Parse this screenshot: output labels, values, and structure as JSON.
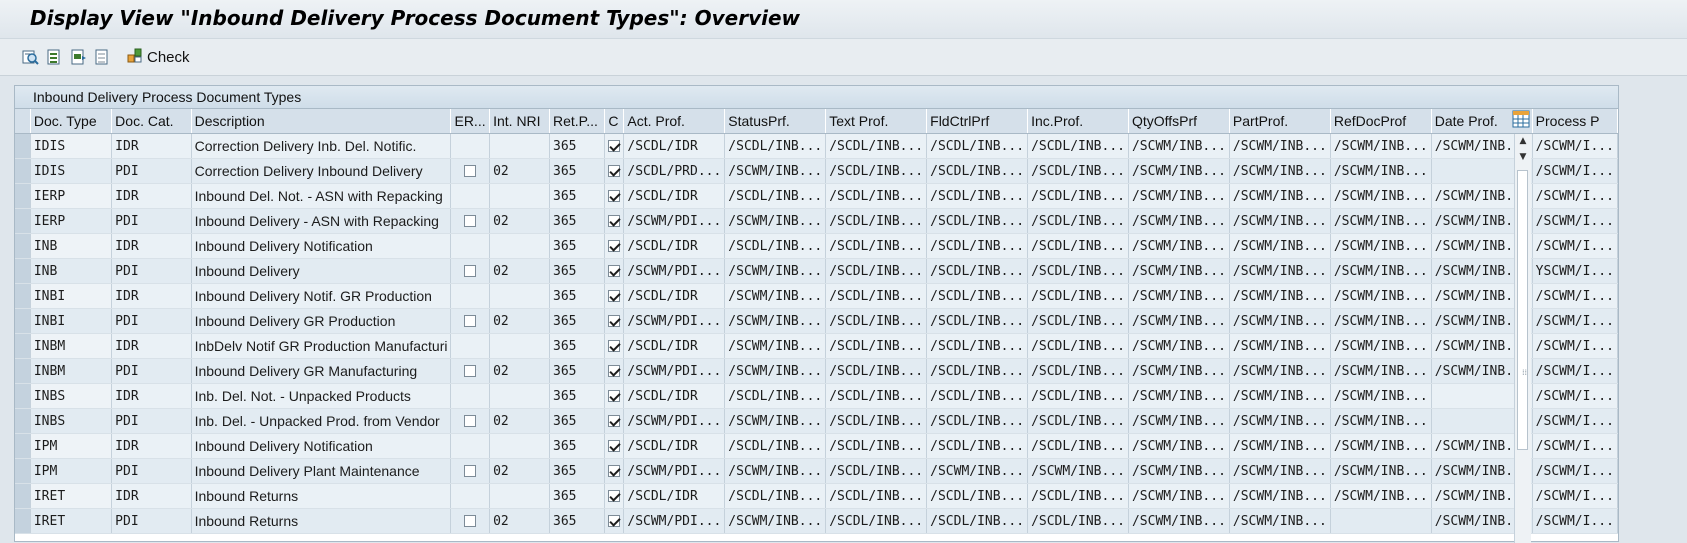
{
  "title": "Display View \"Inbound Delivery Process Document Types\": Overview",
  "toolbar": {
    "buttons": [
      "details-icon",
      "select-all-icon",
      "select-block-icon",
      "deselect-all-icon"
    ],
    "check_label": "Check"
  },
  "panel_title": "Inbound Delivery Process Document Types",
  "columns": [
    "Doc. Type",
    "Doc. Cat.",
    "Description",
    "ER...",
    "Int. NRI",
    "Ret.P...",
    "C",
    "Act. Prof.",
    "StatusPrf.",
    "Text Prof.",
    "FldCtrlPrf",
    "Inc.Prof.",
    "QtyOffsPrf",
    "PartProf.",
    "RefDocProf",
    "Date Prof.",
    "Process P"
  ],
  "rows": [
    {
      "doc_type": "IDIS",
      "doc_cat": "IDR",
      "desc": "Correction Delivery Inb. Del. Notific.",
      "er": false,
      "er_shown": false,
      "int_nri": "",
      "ret": "365",
      "c": true,
      "act": "/SCDL/IDR",
      "status": "/SCDL/INB...",
      "text": "/SCDL/INB...",
      "fld": "/SCDL/INB...",
      "inc": "/SCDL/INB...",
      "qty": "/SCWM/INB...",
      "part": "/SCWM/INB...",
      "ref": "/SCWM/INB...",
      "date": "/SCWM/INB...",
      "proc": "/SCWM/I..."
    },
    {
      "doc_type": "IDIS",
      "doc_cat": "PDI",
      "desc": "Correction Delivery Inbound Delivery",
      "er": false,
      "er_shown": true,
      "int_nri": "02",
      "ret": "365",
      "c": true,
      "act": "/SCDL/PRD...",
      "status": "/SCWM/INB...",
      "text": "/SCDL/INB...",
      "fld": "/SCDL/INB...",
      "inc": "/SCDL/INB...",
      "qty": "/SCWM/INB...",
      "part": "/SCWM/INB...",
      "ref": "/SCWM/INB...",
      "date": "",
      "proc": "/SCWM/I..."
    },
    {
      "doc_type": "IERP",
      "doc_cat": "IDR",
      "desc": "Inbound Del. Not. - ASN with Repacking",
      "er": false,
      "er_shown": false,
      "int_nri": "",
      "ret": "365",
      "c": true,
      "act": "/SCDL/IDR",
      "status": "/SCDL/INB...",
      "text": "/SCDL/INB...",
      "fld": "/SCDL/INB...",
      "inc": "/SCDL/INB...",
      "qty": "/SCWM/INB...",
      "part": "/SCWM/INB...",
      "ref": "/SCWM/INB...",
      "date": "/SCWM/INB...",
      "proc": "/SCWM/I..."
    },
    {
      "doc_type": "IERP",
      "doc_cat": "PDI",
      "desc": "Inbound Delivery - ASN with Repacking",
      "er": false,
      "er_shown": true,
      "int_nri": "02",
      "ret": "365",
      "c": true,
      "act": "/SCWM/PDI...",
      "status": "/SCWM/INB...",
      "text": "/SCDL/INB...",
      "fld": "/SCDL/INB...",
      "inc": "/SCDL/INB...",
      "qty": "/SCWM/INB...",
      "part": "/SCWM/INB...",
      "ref": "/SCWM/INB...",
      "date": "/SCWM/INB...",
      "proc": "/SCWM/I..."
    },
    {
      "doc_type": "INB",
      "doc_cat": "IDR",
      "desc": "Inbound Delivery Notification",
      "er": false,
      "er_shown": false,
      "int_nri": "",
      "ret": "365",
      "c": true,
      "act": "/SCDL/IDR",
      "status": "/SCDL/INB...",
      "text": "/SCDL/INB...",
      "fld": "/SCDL/INB...",
      "inc": "/SCDL/INB...",
      "qty": "/SCWM/INB...",
      "part": "/SCWM/INB...",
      "ref": "/SCWM/INB...",
      "date": "/SCWM/INB...",
      "proc": "/SCWM/I..."
    },
    {
      "doc_type": "INB",
      "doc_cat": "PDI",
      "desc": "Inbound Delivery",
      "er": false,
      "er_shown": true,
      "int_nri": "02",
      "ret": "365",
      "c": true,
      "act": "/SCWM/PDI...",
      "status": "/SCWM/INB...",
      "text": "/SCDL/INB...",
      "fld": "/SCDL/INB...",
      "inc": "/SCDL/INB...",
      "qty": "/SCWM/INB...",
      "part": "/SCWM/INB...",
      "ref": "/SCWM/INB...",
      "date": "/SCWM/INB...",
      "proc": "YSCWM/I..."
    },
    {
      "doc_type": "INBI",
      "doc_cat": "IDR",
      "desc": "Inbound Delivery Notif. GR Production",
      "er": false,
      "er_shown": false,
      "int_nri": "",
      "ret": "365",
      "c": true,
      "act": "/SCDL/IDR",
      "status": "/SCWM/INB...",
      "text": "/SCDL/INB...",
      "fld": "/SCDL/INB...",
      "inc": "/SCDL/INB...",
      "qty": "/SCWM/INB...",
      "part": "/SCWM/INB...",
      "ref": "/SCWM/INB...",
      "date": "/SCWM/INB...",
      "proc": "/SCWM/I..."
    },
    {
      "doc_type": "INBI",
      "doc_cat": "PDI",
      "desc": "Inbound Delivery GR Production",
      "er": false,
      "er_shown": true,
      "int_nri": "02",
      "ret": "365",
      "c": true,
      "act": "/SCWM/PDI...",
      "status": "/SCWM/INB...",
      "text": "/SCDL/INB...",
      "fld": "/SCDL/INB...",
      "inc": "/SCDL/INB...",
      "qty": "/SCWM/INB...",
      "part": "/SCWM/INB...",
      "ref": "/SCWM/INB...",
      "date": "/SCWM/INB...",
      "proc": "/SCWM/I..."
    },
    {
      "doc_type": "INBM",
      "doc_cat": "IDR",
      "desc": "InbDelv Notif GR Production Manufacturi",
      "er": false,
      "er_shown": false,
      "int_nri": "",
      "ret": "365",
      "c": true,
      "act": "/SCDL/IDR",
      "status": "/SCWM/INB...",
      "text": "/SCDL/INB...",
      "fld": "/SCDL/INB...",
      "inc": "/SCDL/INB...",
      "qty": "/SCWM/INB...",
      "part": "/SCWM/INB...",
      "ref": "/SCWM/INB...",
      "date": "/SCWM/INB...",
      "proc": "/SCWM/I..."
    },
    {
      "doc_type": "INBM",
      "doc_cat": "PDI",
      "desc": "Inbound Delivery GR Manufacturing",
      "er": false,
      "er_shown": true,
      "int_nri": "02",
      "ret": "365",
      "c": true,
      "act": "/SCWM/PDI...",
      "status": "/SCWM/INB...",
      "text": "/SCDL/INB...",
      "fld": "/SCDL/INB...",
      "inc": "/SCDL/INB...",
      "qty": "/SCWM/INB...",
      "part": "/SCWM/INB...",
      "ref": "/SCWM/INB...",
      "date": "/SCWM/INB...",
      "proc": "/SCWM/I..."
    },
    {
      "doc_type": "INBS",
      "doc_cat": "IDR",
      "desc": "Inb. Del. Not. - Unpacked Products",
      "er": false,
      "er_shown": false,
      "int_nri": "",
      "ret": "365",
      "c": true,
      "act": "/SCDL/IDR",
      "status": "/SCDL/INB...",
      "text": "/SCDL/INB...",
      "fld": "/SCDL/INB...",
      "inc": "/SCDL/INB...",
      "qty": "/SCWM/INB...",
      "part": "/SCWM/INB...",
      "ref": "/SCWM/INB...",
      "date": "",
      "proc": "/SCWM/I..."
    },
    {
      "doc_type": "INBS",
      "doc_cat": "PDI",
      "desc": "Inb. Del. - Unpacked Prod. from Vendor",
      "er": false,
      "er_shown": true,
      "int_nri": "02",
      "ret": "365",
      "c": true,
      "act": "/SCWM/PDI...",
      "status": "/SCWM/INB...",
      "text": "/SCDL/INB...",
      "fld": "/SCDL/INB...",
      "inc": "/SCDL/INB...",
      "qty": "/SCWM/INB...",
      "part": "/SCWM/INB...",
      "ref": "/SCWM/INB...",
      "date": "",
      "proc": "/SCWM/I..."
    },
    {
      "doc_type": "IPM",
      "doc_cat": "IDR",
      "desc": "Inbound Delivery Notification",
      "er": false,
      "er_shown": false,
      "int_nri": "",
      "ret": "365",
      "c": true,
      "act": "/SCDL/IDR",
      "status": "/SCDL/INB...",
      "text": "/SCDL/INB...",
      "fld": "/SCDL/INB...",
      "inc": "/SCDL/INB...",
      "qty": "/SCWM/INB...",
      "part": "/SCWM/INB...",
      "ref": "/SCWM/INB...",
      "date": "/SCWM/INB...",
      "proc": "/SCWM/I..."
    },
    {
      "doc_type": "IPM",
      "doc_cat": "PDI",
      "desc": "Inbound Delivery Plant Maintenance",
      "er": false,
      "er_shown": true,
      "int_nri": "02",
      "ret": "365",
      "c": true,
      "act": "/SCWM/PDI...",
      "status": "/SCWM/INB...",
      "text": "/SCDL/INB...",
      "fld": "/SCWM/INB...",
      "inc": "/SCWM/INB...",
      "qty": "/SCWM/INB...",
      "part": "/SCWM/INB...",
      "ref": "/SCWM/INB...",
      "date": "/SCWM/INB...",
      "proc": "/SCWM/I..."
    },
    {
      "doc_type": "IRET",
      "doc_cat": "IDR",
      "desc": "Inbound Returns",
      "er": false,
      "er_shown": false,
      "int_nri": "",
      "ret": "365",
      "c": true,
      "act": "/SCDL/IDR",
      "status": "/SCDL/INB...",
      "text": "/SCDL/INB...",
      "fld": "/SCDL/INB...",
      "inc": "/SCDL/INB...",
      "qty": "/SCWM/INB...",
      "part": "/SCWM/INB...",
      "ref": "/SCWM/INB...",
      "date": "/SCWM/INB...",
      "proc": "/SCWM/I..."
    },
    {
      "doc_type": "IRET",
      "doc_cat": "PDI",
      "desc": "Inbound Returns",
      "er": false,
      "er_shown": true,
      "int_nri": "02",
      "ret": "365",
      "c": true,
      "act": "/SCWM/PDI...",
      "status": "/SCWM/INB...",
      "text": "/SCDL/INB...",
      "fld": "/SCDL/INB...",
      "inc": "/SCDL/INB...",
      "qty": "/SCWM/INB...",
      "part": "/SCWM/INB...",
      "ref": "",
      "date": "/SCWM/INB...",
      "proc": "/SCWM/I..."
    }
  ],
  "icons": {
    "table_settings": "table-settings-icon",
    "scroll_up": "scroll-up-icon",
    "scroll_down": "scroll-down-icon"
  }
}
